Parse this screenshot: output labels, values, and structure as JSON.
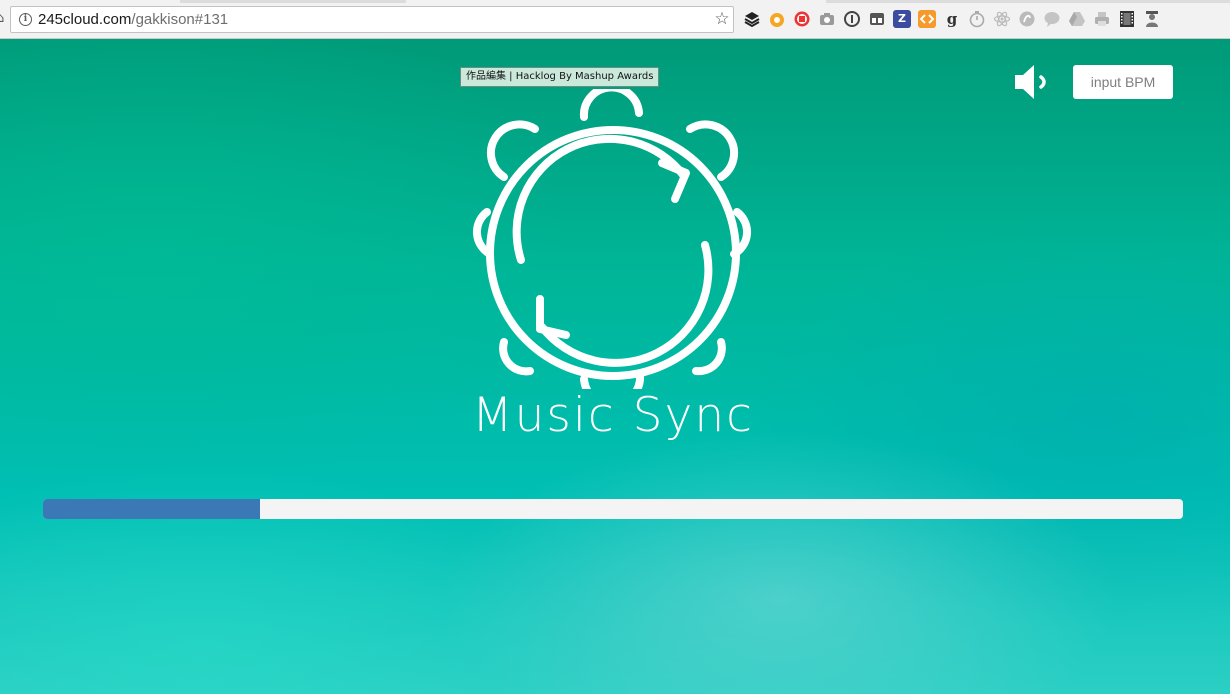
{
  "browser": {
    "url_host": "245cloud.com",
    "url_path": "/gakkison#131",
    "icons": {
      "site_info": "info-icon",
      "bookmark": "star-icon",
      "extensions": [
        "layers-icon",
        "honey-icon",
        "record-icon",
        "camera-icon",
        "i-icon",
        "tabs-icon",
        "zotero-icon",
        "code-icon",
        "goodreads-icon",
        "timer-icon",
        "react-icon",
        "evernote-icon",
        "chat-icon",
        "drive-icon",
        "printer-icon",
        "film-icon",
        "user-icon"
      ]
    },
    "extension_letters": [
      "",
      "",
      "",
      "",
      "i",
      "",
      "Z",
      "",
      "g",
      "",
      "",
      "",
      "",
      "",
      "",
      "",
      ""
    ]
  },
  "page": {
    "tooltip_text": "作品編集 | Hacklog By Mashup Awards",
    "title": "Music Sync",
    "bpm_button_label": "input BPM",
    "progress": 0.19,
    "colors": {
      "background_top": "#009a78",
      "background_bottom": "#2ccfc4",
      "progress_fill": "#3a78b6",
      "progress_track": "#f4f4f4"
    },
    "icons": {
      "sound": "speaker-icon",
      "logo": "tambourine-sync-icon"
    }
  }
}
